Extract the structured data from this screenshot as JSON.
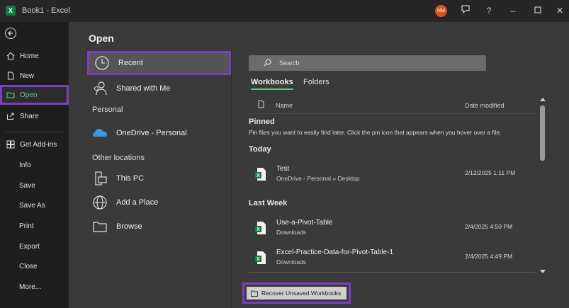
{
  "window": {
    "title": "Book1  -  Excel",
    "avatar_initials": "NM"
  },
  "sidebar": {
    "items": [
      {
        "label": "Home"
      },
      {
        "label": "New"
      },
      {
        "label": "Open"
      },
      {
        "label": "Share"
      },
      {
        "label": "Get Add-ins"
      },
      {
        "label": "Info"
      },
      {
        "label": "Save"
      },
      {
        "label": "Save As"
      },
      {
        "label": "Print"
      },
      {
        "label": "Export"
      },
      {
        "label": "Close"
      },
      {
        "label": "More..."
      }
    ]
  },
  "open": {
    "title": "Open",
    "locations": {
      "recent": "Recent",
      "shared": "Shared with Me",
      "personal_header": "Personal",
      "onedrive": "OneDrive - Personal",
      "other_header": "Other locations",
      "this_pc": "This PC",
      "add_place": "Add a Place",
      "browse": "Browse"
    },
    "search_placeholder": "Search",
    "tabs": {
      "workbooks": "Workbooks",
      "folders": "Folders"
    },
    "columns": {
      "name": "Name",
      "date": "Date modified"
    },
    "groups": {
      "pinned": "Pinned",
      "pinned_hint": "Pin files you want to easily find later. Click the pin icon that appears when you hover over a file.",
      "today": "Today",
      "last_week": "Last Week"
    },
    "files": [
      {
        "name": "Test",
        "path": "OneDrive - Personal » Desktop",
        "date": "2/12/2025 1:11 PM"
      },
      {
        "name": "Use-a-Pivot-Table",
        "path": "Downloads",
        "date": "2/4/2025 4:50 PM"
      },
      {
        "name": "Excel-Practice-Data-for-Pivot-Table-1",
        "path": "Downloads",
        "date": "2/4/2025 4:49 PM"
      }
    ],
    "recover_label": "Recover Unsaved Workbooks"
  },
  "colors": {
    "accent_highlight": "#7b3fc4",
    "excel_green": "#107c41",
    "active_green": "#63c987"
  }
}
